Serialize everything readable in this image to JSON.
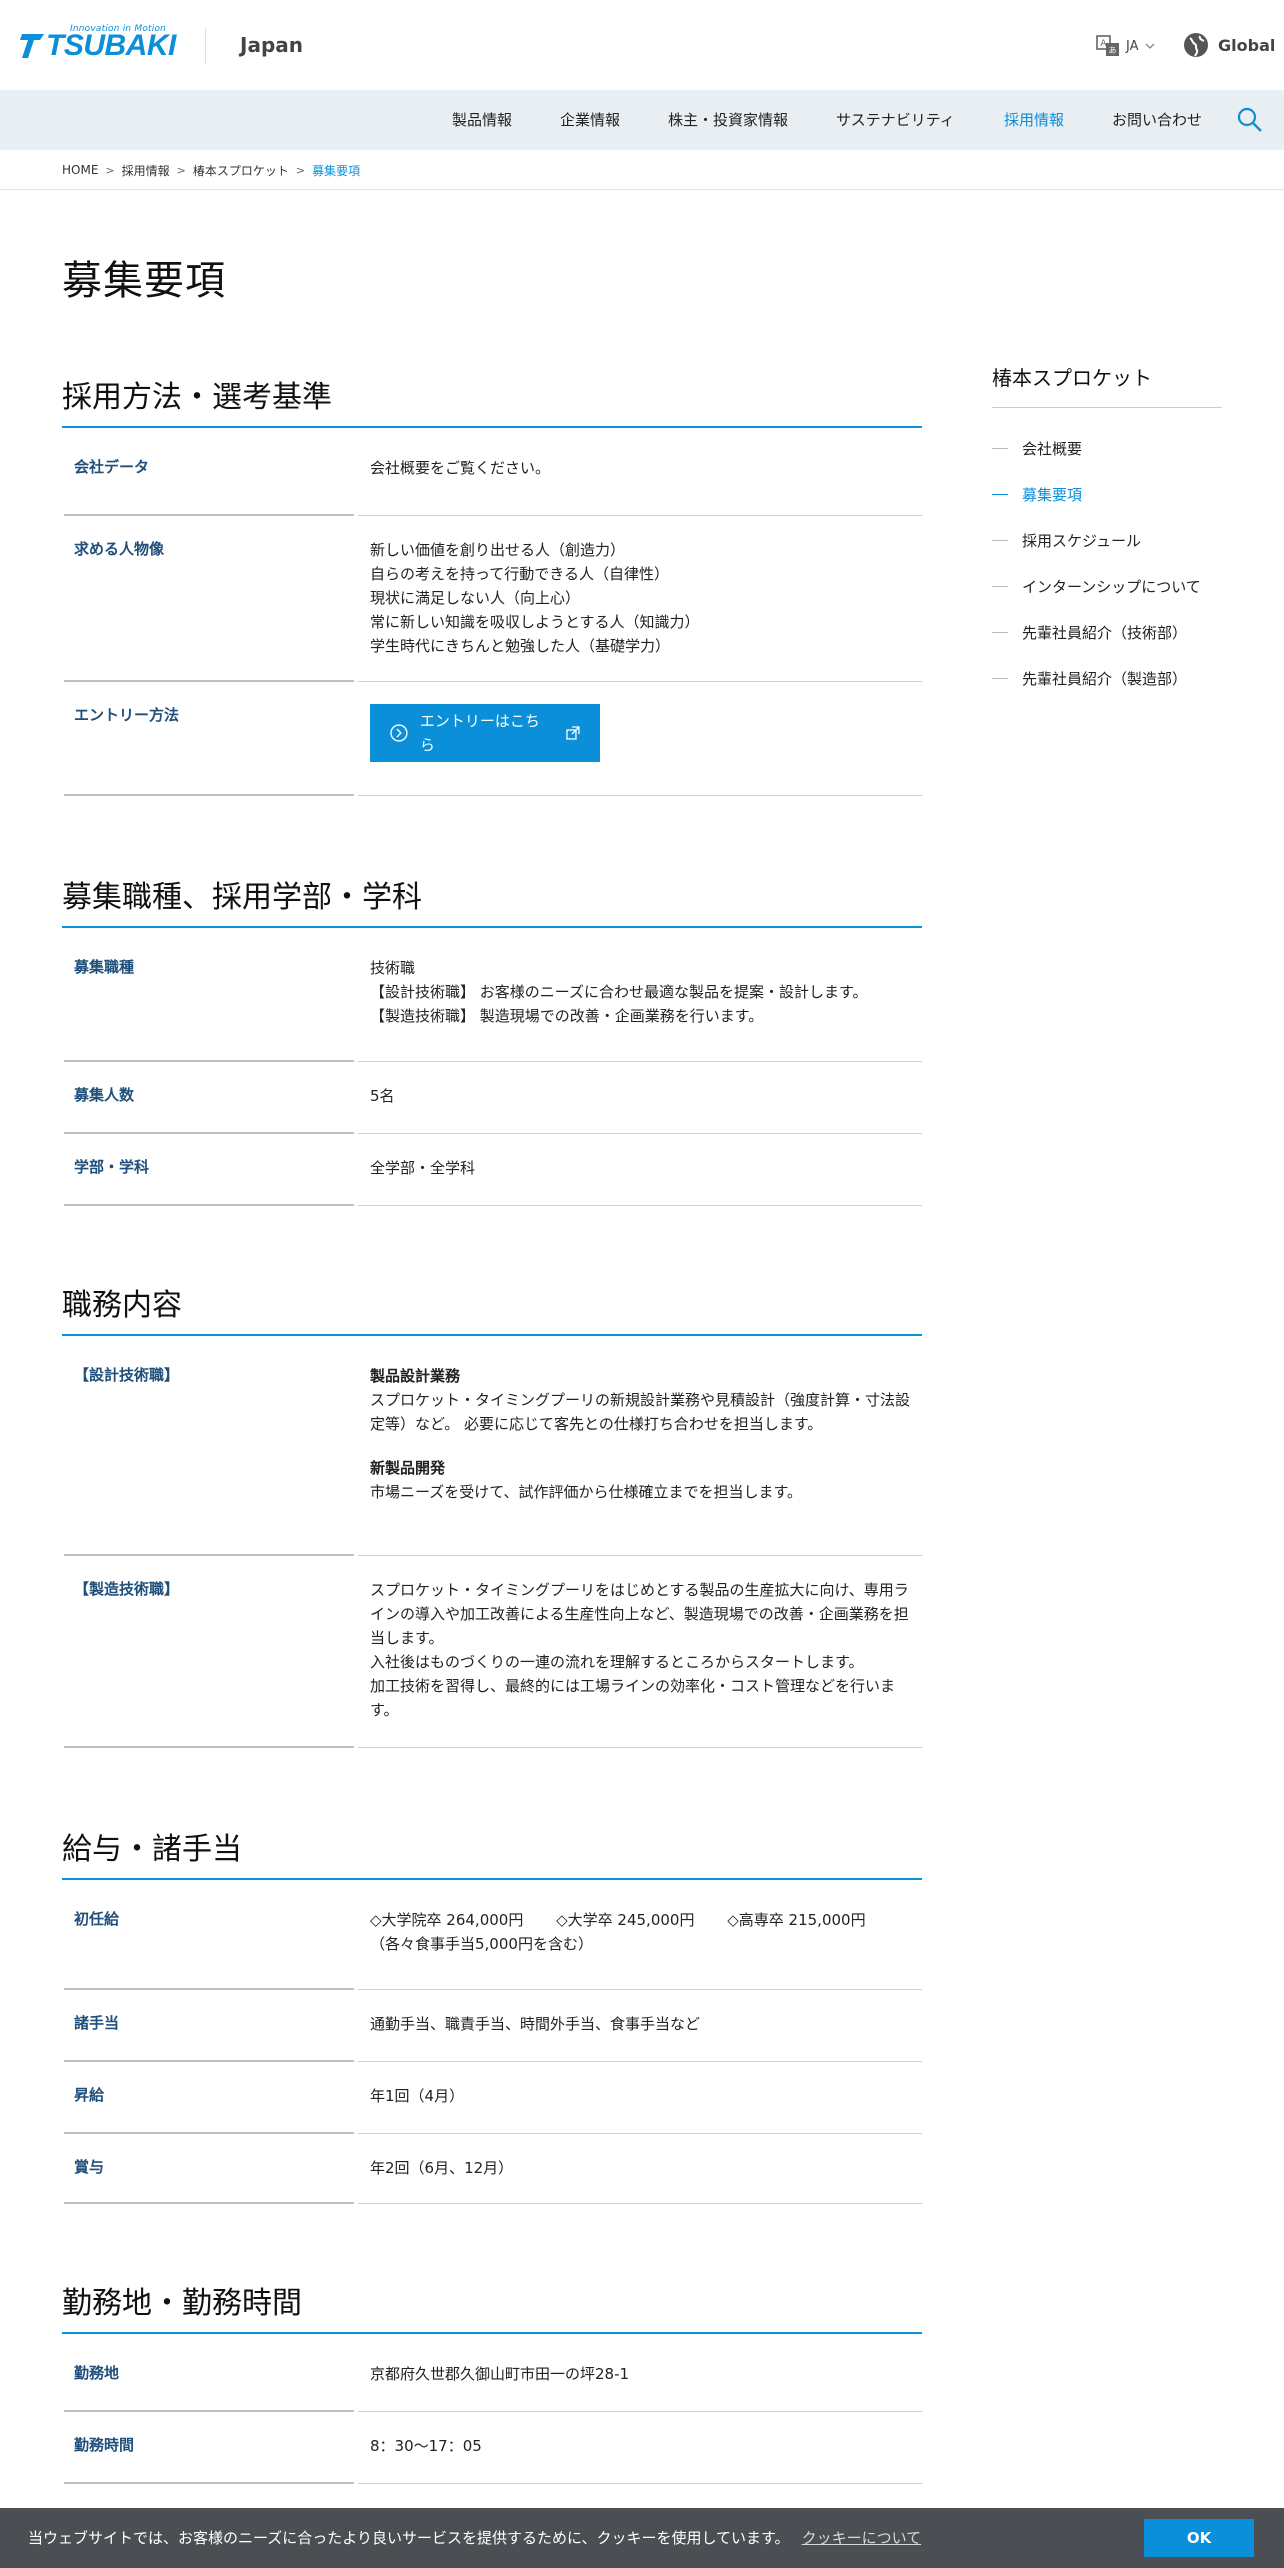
{
  "header": {
    "logo_tagline": "Innovation in Motion",
    "logo_word": "TSUBAKI",
    "region": "Japan",
    "lang": "JA",
    "global": "Global"
  },
  "nav": {
    "items": [
      {
        "label": "製品情報"
      },
      {
        "label": "企業情報"
      },
      {
        "label": "株主・投資家情報"
      },
      {
        "label": "サステナビリティ"
      },
      {
        "label": "採用情報",
        "active": true
      },
      {
        "label": "お問い合わせ"
      }
    ]
  },
  "breadcrumb": [
    "HOME",
    "採用情報",
    "椿本スプロケット",
    "募集要項"
  ],
  "page_title": "募集要項",
  "sections": {
    "s1": {
      "title": "採用方法・選考基準",
      "rows": [
        {
          "th": "会社データ",
          "lines": [
            "会社概要をご覧ください。"
          ]
        },
        {
          "th": "求める人物像",
          "lines": [
            "新しい価値を創り出せる人（創造力）",
            "自らの考えを持って行動できる人（自律性）",
            "現状に満足しない人（向上心）",
            "常に新しい知識を吸収しようとする人（知識力）",
            "学生時代にきちんと勉強した人（基礎学力）"
          ]
        },
        {
          "th": "エントリー方法",
          "button": "エントリーはこちら"
        }
      ]
    },
    "s2": {
      "title": "募集職種、採用学部・学科",
      "rows": [
        {
          "th": "募集職種",
          "lines": [
            "技術職",
            "【設計技術職】 お客様のニーズに合わせ最適な製品を提案・設計します。",
            "【製造技術職】 製造現場での改善・企画業務を行います。"
          ]
        },
        {
          "th": "募集人数",
          "lines": [
            "5名"
          ]
        },
        {
          "th": "学部・学科",
          "lines": [
            "全学部・全学科"
          ]
        }
      ]
    },
    "s3": {
      "title": "職務内容",
      "rows": [
        {
          "th": "【設計技術職】",
          "heading1": "製品設計業務",
          "lines1": [
            "スプロケット・タイミングプーリの新規設計業務や見積設計（強度計算・寸法設",
            "定等）など。 必要に応じて客先との仕様打ち合わせを担当します。"
          ],
          "heading2": "新製品開発",
          "lines2": [
            "市場ニーズを受けて、試作評価から仕様確立までを担当します。"
          ]
        },
        {
          "th": "【製造技術職】",
          "lines": [
            "スプロケット・タイミングプーリをはじめとする製品の生産拡大に向け、専用ラ",
            "インの導入や加工改善による生産性向上など、製造現場での改善・企画業務を担",
            "当します。",
            "入社後はものづくりの一連の流れを理解するところからスタートします。",
            "加工技術を習得し、最終的には工場ラインの効率化・コスト管理などを行いま",
            "す。"
          ]
        }
      ]
    },
    "s4": {
      "title": "給与・諸手当",
      "rows": [
        {
          "th": "初任給",
          "salaries": [
            "◇大学院卒 264,000円",
            "◇大学卒 245,000円",
            "◇高専卒 215,000円"
          ],
          "note": "（各々食事手当5,000円を含む）"
        },
        {
          "th": "諸手当",
          "lines": [
            "通勤手当、職責手当、時間外手当、食事手当など"
          ]
        },
        {
          "th": "昇給",
          "lines": [
            "年1回（4月）"
          ]
        },
        {
          "th": "賞与",
          "lines": [
            "年2回（6月、12月）"
          ]
        }
      ]
    },
    "s5": {
      "title": "勤務地・勤務時間",
      "rows": [
        {
          "th": "勤務地",
          "lines": [
            "京都府久世郡久御山町市田一の坪28-1"
          ]
        },
        {
          "th": "勤務時間",
          "lines": [
            "8：30～17：05"
          ]
        }
      ]
    }
  },
  "sidebar": {
    "title": "椿本スプロケット",
    "items": [
      {
        "label": "会社概要"
      },
      {
        "label": "募集要項",
        "active": true
      },
      {
        "label": "採用スケジュール"
      },
      {
        "label": "インターンシップについて"
      },
      {
        "label": "先輩社員紹介（技術部）"
      },
      {
        "label": "先輩社員紹介（製造部）"
      }
    ]
  },
  "cookie": {
    "text": "当ウェブサイトでは、お客様のニーズに合ったより良いサービスを提供するために、クッキーを使用しています。",
    "link": "クッキーについて",
    "ok": "OK"
  },
  "colors": {
    "accent": "#0a8fd8",
    "nav_bg": "#e8eef2",
    "cookie_bg": "#4b4f54"
  }
}
